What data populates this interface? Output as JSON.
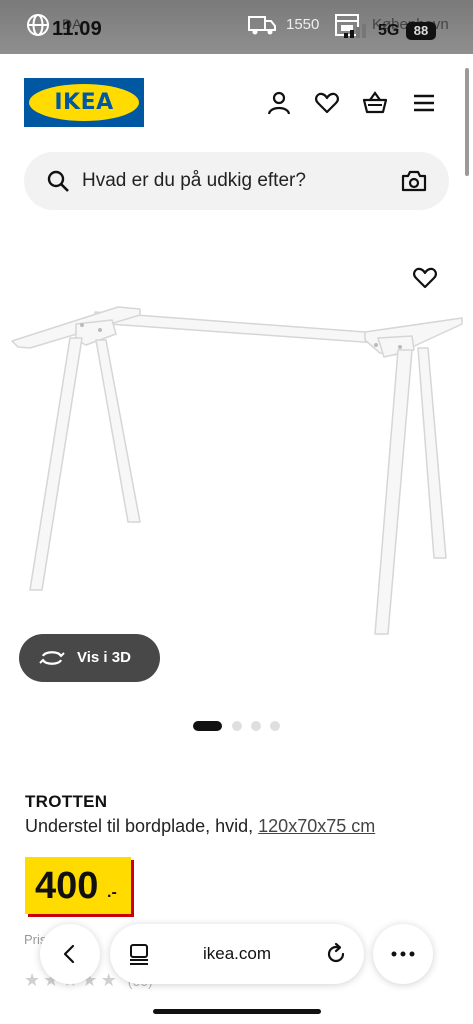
{
  "status_bar": {
    "region": "DA",
    "time": "11.09",
    "phone_number": "1550",
    "location": "København",
    "network": "5G",
    "battery": "88"
  },
  "header": {
    "logo_text": "IKEA",
    "icons": [
      "user-icon",
      "heart-icon",
      "basket-icon",
      "menu-icon"
    ]
  },
  "search": {
    "placeholder": "Hvad er du på udkig efter?"
  },
  "gallery": {
    "view_3d_label": "Vis i 3D",
    "slide_count": 4,
    "active_slide": 1
  },
  "product": {
    "name": "TROTTEN",
    "description": "Understel til bordplade, hvid,",
    "size": "120x70x75 cm",
    "price_main": "400",
    "price_decimal": ".-",
    "previous_price_text": "Pris      hor",
    "rating_count": "(66)"
  },
  "browser": {
    "domain": "ikea.com"
  },
  "colors": {
    "ikea_blue": "#0058a3",
    "ikea_yellow": "#ffdb00",
    "price_red": "#cc0008",
    "button_dark": "#484848"
  }
}
